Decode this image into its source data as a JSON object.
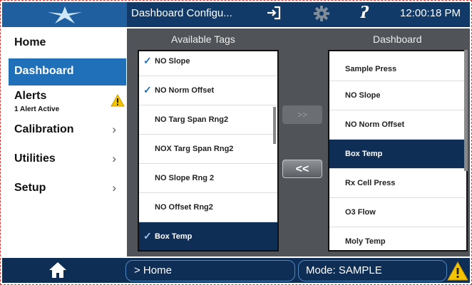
{
  "header": {
    "title": "Dashboard Configu...",
    "clock": "12:00:18 PM",
    "icons": [
      "logo-icon",
      "login-icon",
      "gear-icon",
      "help-icon"
    ]
  },
  "sidebar": {
    "items": [
      {
        "label": "Home"
      },
      {
        "label": "Dashboard",
        "active": true
      },
      {
        "label": "Alerts",
        "sub": "1 Alert Active"
      },
      {
        "label": "Calibration",
        "chevron": "›"
      },
      {
        "label": "Utilities",
        "chevron": "›"
      },
      {
        "label": "Setup",
        "chevron": "›"
      }
    ]
  },
  "available": {
    "header": "Available Tags",
    "rows": [
      {
        "label": "NO Slope",
        "check": "✓"
      },
      {
        "label": "NO Norm Offset",
        "check": "✓"
      },
      {
        "label": "NO Targ Span Rng2"
      },
      {
        "label": "NOX Targ Span Rng2"
      },
      {
        "label": "NO Slope Rng 2"
      },
      {
        "label": "NO Offset Rng2"
      },
      {
        "label": "Box Temp",
        "check": "✓"
      }
    ]
  },
  "dashboard": {
    "header": "Dashboard",
    "rows": [
      {
        "label": "Sample Press"
      },
      {
        "label": "NO Slope"
      },
      {
        "label": "NO Norm Offset"
      },
      {
        "label": "Box Temp"
      },
      {
        "label": "Rx Cell Press"
      },
      {
        "label": "O3 Flow"
      },
      {
        "label": "Moly Temp"
      }
    ]
  },
  "buttons": {
    "add": ">>",
    "remove": "<<"
  },
  "footer": {
    "path": "> Home",
    "mode": "Mode: SAMPLE"
  },
  "colors": {
    "topbar": "#113a68",
    "active": "#1f6fb9",
    "selected": "#0e2e56",
    "panel": "#505458",
    "warning": "#f5c400"
  }
}
